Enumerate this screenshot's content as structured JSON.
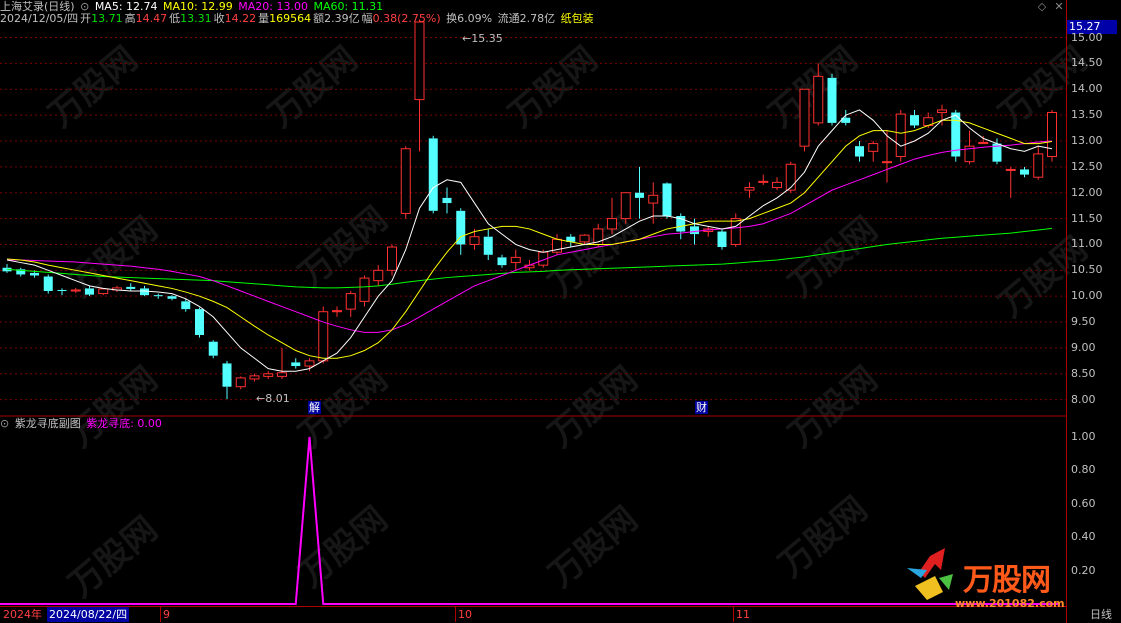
{
  "header": {
    "stock_name": "上海艾录(日线)",
    "ma5": "MA5: 12.74",
    "ma10": "MA10: 12.99",
    "ma20": "MA20: 13.00",
    "ma60": "MA60: 11.31",
    "date": "2024/12/05/四",
    "open_label": "开",
    "open": "13.71",
    "high_label": "高",
    "high": "14.47",
    "low_label": "低",
    "low": "13.31",
    "close_label": "收",
    "close": "14.22",
    "vol_label": "量",
    "vol": "169564",
    "amt_label": "额",
    "amt": "2.39亿",
    "chg_label": "幅",
    "chg": "0.38(2.75%)",
    "turnover": "换6.09%",
    "float": "流通2.78亿",
    "sector": "纸包装"
  },
  "indicator": {
    "name": "紫龙寻底副图",
    "value_label": "紫龙寻底: 0.00"
  },
  "price_axis": {
    "current": "15.27",
    "ticks": [
      "15.00",
      "14.50",
      "14.00",
      "13.50",
      "13.00",
      "12.50",
      "12.00",
      "11.50",
      "11.00",
      "10.50",
      "10.00",
      "9.50",
      "9.00",
      "8.50",
      "8.00"
    ]
  },
  "indicator_axis": {
    "ticks": [
      "1.00",
      "0.80",
      "0.60",
      "0.40",
      "0.20"
    ]
  },
  "annotations": {
    "high_marker": "15.35",
    "low_marker": "8.01",
    "event1": "解",
    "event2": "财"
  },
  "bottom_bar": {
    "year": "2024年",
    "cursor_date": "2024/08/22/四",
    "months": [
      "9",
      "10",
      "11"
    ],
    "period": "日线"
  },
  "watermark": {
    "brand": "万股网",
    "url": "www.201082.com"
  },
  "colors": {
    "up": "#ff3030",
    "down": "#54ffff",
    "ma5": "#ffffff",
    "ma10": "#ffff00",
    "ma20": "#ff00ff",
    "ma60": "#00ff00",
    "indicator": "#ff00ff"
  },
  "chart_data": {
    "type": "candlestick",
    "ylim": [
      7.8,
      15.3
    ],
    "candles": [
      {
        "o": 10.55,
        "h": 10.62,
        "l": 10.45,
        "c": 10.48
      },
      {
        "o": 10.52,
        "h": 10.55,
        "l": 10.38,
        "c": 10.42
      },
      {
        "o": 10.45,
        "h": 10.5,
        "l": 10.36,
        "c": 10.4
      },
      {
        "o": 10.38,
        "h": 10.42,
        "l": 10.05,
        "c": 10.1
      },
      {
        "o": 10.12,
        "h": 10.15,
        "l": 10.02,
        "c": 10.1
      },
      {
        "o": 10.1,
        "h": 10.16,
        "l": 10.06,
        "c": 10.12
      },
      {
        "o": 10.15,
        "h": 10.2,
        "l": 10.0,
        "c": 10.03
      },
      {
        "o": 10.05,
        "h": 10.16,
        "l": 10.02,
        "c": 10.14
      },
      {
        "o": 10.12,
        "h": 10.2,
        "l": 10.08,
        "c": 10.16
      },
      {
        "o": 10.18,
        "h": 10.25,
        "l": 10.1,
        "c": 10.14
      },
      {
        "o": 10.15,
        "h": 10.2,
        "l": 10.0,
        "c": 10.02
      },
      {
        "o": 10.02,
        "h": 10.05,
        "l": 9.95,
        "c": 10.0
      },
      {
        "o": 10.0,
        "h": 10.02,
        "l": 9.92,
        "c": 9.95
      },
      {
        "o": 9.9,
        "h": 9.95,
        "l": 9.7,
        "c": 9.75
      },
      {
        "o": 9.75,
        "h": 9.78,
        "l": 9.2,
        "c": 9.25
      },
      {
        "o": 9.12,
        "h": 9.15,
        "l": 8.8,
        "c": 8.85
      },
      {
        "o": 8.7,
        "h": 8.75,
        "l": 8.01,
        "c": 8.25
      },
      {
        "o": 8.25,
        "h": 8.45,
        "l": 8.2,
        "c": 8.42
      },
      {
        "o": 8.4,
        "h": 8.5,
        "l": 8.35,
        "c": 8.46
      },
      {
        "o": 8.45,
        "h": 8.55,
        "l": 8.4,
        "c": 8.5
      },
      {
        "o": 8.45,
        "h": 9.0,
        "l": 8.4,
        "c": 8.52
      },
      {
        "o": 8.72,
        "h": 8.8,
        "l": 8.6,
        "c": 8.65
      },
      {
        "o": 8.65,
        "h": 8.8,
        "l": 8.55,
        "c": 8.75
      },
      {
        "o": 8.75,
        "h": 9.8,
        "l": 8.7,
        "c": 9.7
      },
      {
        "o": 9.7,
        "h": 9.8,
        "l": 9.6,
        "c": 9.72
      },
      {
        "o": 9.75,
        "h": 10.1,
        "l": 9.6,
        "c": 10.05
      },
      {
        "o": 9.9,
        "h": 10.4,
        "l": 9.8,
        "c": 10.35
      },
      {
        "o": 10.3,
        "h": 10.6,
        "l": 10.2,
        "c": 10.5
      },
      {
        "o": 10.5,
        "h": 11.0,
        "l": 10.4,
        "c": 10.95
      },
      {
        "o": 11.6,
        "h": 12.9,
        "l": 11.5,
        "c": 12.85
      },
      {
        "o": 13.8,
        "h": 15.35,
        "l": 12.8,
        "c": 15.3
      },
      {
        "o": 13.05,
        "h": 13.1,
        "l": 11.6,
        "c": 11.65
      },
      {
        "o": 11.9,
        "h": 12.1,
        "l": 11.6,
        "c": 11.8
      },
      {
        "o": 11.65,
        "h": 11.7,
        "l": 10.8,
        "c": 11.0
      },
      {
        "o": 11.0,
        "h": 11.3,
        "l": 10.9,
        "c": 11.15
      },
      {
        "o": 11.15,
        "h": 11.3,
        "l": 10.7,
        "c": 10.8
      },
      {
        "o": 10.75,
        "h": 10.8,
        "l": 10.55,
        "c": 10.6
      },
      {
        "o": 10.65,
        "h": 10.9,
        "l": 10.5,
        "c": 10.75
      },
      {
        "o": 10.55,
        "h": 10.7,
        "l": 10.5,
        "c": 10.6
      },
      {
        "o": 10.6,
        "h": 10.9,
        "l": 10.55,
        "c": 10.85
      },
      {
        "o": 10.85,
        "h": 11.2,
        "l": 10.8,
        "c": 11.1
      },
      {
        "o": 11.15,
        "h": 11.2,
        "l": 10.95,
        "c": 11.05
      },
      {
        "o": 11.05,
        "h": 11.2,
        "l": 11.0,
        "c": 11.18
      },
      {
        "o": 11.0,
        "h": 11.4,
        "l": 10.95,
        "c": 11.3
      },
      {
        "o": 11.3,
        "h": 11.9,
        "l": 11.2,
        "c": 11.5
      },
      {
        "o": 11.5,
        "h": 12.0,
        "l": 11.4,
        "c": 12.0
      },
      {
        "o": 12.0,
        "h": 12.5,
        "l": 11.5,
        "c": 11.9
      },
      {
        "o": 11.8,
        "h": 12.2,
        "l": 11.4,
        "c": 11.95
      },
      {
        "o": 12.18,
        "h": 12.2,
        "l": 11.5,
        "c": 11.55
      },
      {
        "o": 11.55,
        "h": 11.6,
        "l": 11.1,
        "c": 11.25
      },
      {
        "o": 11.35,
        "h": 11.5,
        "l": 11.0,
        "c": 11.2
      },
      {
        "o": 11.25,
        "h": 11.35,
        "l": 11.15,
        "c": 11.3
      },
      {
        "o": 11.25,
        "h": 11.3,
        "l": 10.9,
        "c": 10.95
      },
      {
        "o": 11.0,
        "h": 11.6,
        "l": 10.95,
        "c": 11.5
      },
      {
        "o": 12.05,
        "h": 12.2,
        "l": 11.9,
        "c": 12.1
      },
      {
        "o": 12.2,
        "h": 12.35,
        "l": 12.15,
        "c": 12.22
      },
      {
        "o": 12.1,
        "h": 12.3,
        "l": 12.05,
        "c": 12.2
      },
      {
        "o": 12.05,
        "h": 12.6,
        "l": 12.0,
        "c": 12.55
      },
      {
        "o": 12.9,
        "h": 14.0,
        "l": 12.8,
        "c": 14.0
      },
      {
        "o": 13.35,
        "h": 14.5,
        "l": 13.3,
        "c": 14.25
      },
      {
        "o": 14.22,
        "h": 14.3,
        "l": 13.3,
        "c": 13.35
      },
      {
        "o": 13.45,
        "h": 13.6,
        "l": 13.3,
        "c": 13.35
      },
      {
        "o": 12.9,
        "h": 13.0,
        "l": 12.6,
        "c": 12.7
      },
      {
        "o": 12.8,
        "h": 13.0,
        "l": 12.6,
        "c": 12.95
      },
      {
        "o": 12.6,
        "h": 13.2,
        "l": 12.2,
        "c": 12.6
      },
      {
        "o": 12.7,
        "h": 13.6,
        "l": 12.6,
        "c": 13.52
      },
      {
        "o": 13.5,
        "h": 13.6,
        "l": 13.25,
        "c": 13.3
      },
      {
        "o": 13.3,
        "h": 13.55,
        "l": 13.25,
        "c": 13.45
      },
      {
        "o": 13.55,
        "h": 13.7,
        "l": 13.3,
        "c": 13.6
      },
      {
        "o": 13.55,
        "h": 13.6,
        "l": 12.6,
        "c": 12.7
      },
      {
        "o": 12.6,
        "h": 13.2,
        "l": 12.55,
        "c": 12.9
      },
      {
        "o": 12.95,
        "h": 13.1,
        "l": 12.95,
        "c": 12.97
      },
      {
        "o": 12.95,
        "h": 13.05,
        "l": 12.55,
        "c": 12.6
      },
      {
        "o": 12.45,
        "h": 12.5,
        "l": 11.9,
        "c": 12.45
      },
      {
        "o": 12.45,
        "h": 12.5,
        "l": 12.3,
        "c": 12.35
      },
      {
        "o": 12.3,
        "h": 12.9,
        "l": 12.25,
        "c": 12.75
      },
      {
        "o": 12.7,
        "h": 13.6,
        "l": 12.6,
        "c": 13.55
      }
    ],
    "ma5": [
      10.7,
      10.65,
      10.6,
      10.5,
      10.4,
      10.3,
      10.2,
      10.15,
      10.12,
      10.1,
      10.1,
      10.08,
      10.05,
      9.95,
      9.8,
      9.6,
      9.3,
      9.0,
      8.8,
      8.6,
      8.55,
      8.55,
      8.6,
      8.75,
      8.9,
      9.2,
      9.6,
      10.0,
      10.3,
      10.9,
      11.7,
      12.1,
      12.25,
      12.2,
      11.8,
      11.4,
      11.2,
      11.0,
      10.9,
      10.85,
      10.9,
      10.95,
      11.0,
      11.05,
      11.15,
      11.3,
      11.45,
      11.55,
      11.55,
      11.5,
      11.4,
      11.35,
      11.3,
      11.35,
      11.55,
      11.75,
      11.9,
      12.1,
      12.4,
      12.9,
      13.2,
      13.5,
      13.6,
      13.4,
      13.1,
      12.9,
      13.0,
      13.15,
      13.4,
      13.5,
      13.25,
      13.05,
      12.95,
      12.85,
      12.8,
      12.9,
      12.85
    ],
    "ma10": [
      10.72,
      10.7,
      10.66,
      10.6,
      10.55,
      10.5,
      10.45,
      10.4,
      10.35,
      10.3,
      10.25,
      10.2,
      10.15,
      10.08,
      10.0,
      9.9,
      9.78,
      9.6,
      9.42,
      9.25,
      9.1,
      8.95,
      8.85,
      8.8,
      8.8,
      8.85,
      8.95,
      9.1,
      9.35,
      9.7,
      10.1,
      10.5,
      10.85,
      11.15,
      11.25,
      11.3,
      11.35,
      11.35,
      11.3,
      11.2,
      11.1,
      11.05,
      11.0,
      11.0,
      11.0,
      11.05,
      11.1,
      11.2,
      11.3,
      11.35,
      11.4,
      11.45,
      11.45,
      11.45,
      11.5,
      11.6,
      11.7,
      11.8,
      12.0,
      12.3,
      12.6,
      12.9,
      13.1,
      13.2,
      13.2,
      13.15,
      13.2,
      13.3,
      13.4,
      13.4,
      13.35,
      13.25,
      13.15,
      13.05,
      12.95,
      12.95,
      12.99
    ],
    "ma20": [
      10.7,
      10.7,
      10.69,
      10.68,
      10.67,
      10.66,
      10.64,
      10.62,
      10.6,
      10.58,
      10.55,
      10.52,
      10.48,
      10.43,
      10.38,
      10.3,
      10.2,
      10.1,
      10.0,
      9.9,
      9.8,
      9.7,
      9.6,
      9.5,
      9.42,
      9.35,
      9.3,
      9.3,
      9.35,
      9.45,
      9.6,
      9.75,
      9.9,
      10.05,
      10.2,
      10.3,
      10.4,
      10.5,
      10.6,
      10.7,
      10.8,
      10.85,
      10.9,
      10.95,
      11.0,
      11.05,
      11.1,
      11.15,
      11.2,
      11.22,
      11.25,
      11.28,
      11.3,
      11.32,
      11.35,
      11.4,
      11.5,
      11.6,
      11.75,
      11.9,
      12.05,
      12.15,
      12.25,
      12.35,
      12.45,
      12.55,
      12.65,
      12.72,
      12.78,
      12.82,
      12.85,
      12.88,
      12.9,
      12.92,
      12.95,
      12.98,
      13.0
    ],
    "ma60": [
      10.52,
      10.5,
      10.48,
      10.46,
      10.44,
      10.42,
      10.4,
      10.38,
      10.37,
      10.36,
      10.35,
      10.34,
      10.33,
      10.32,
      10.31,
      10.3,
      10.28,
      10.26,
      10.24,
      10.22,
      10.2,
      10.18,
      10.17,
      10.16,
      10.16,
      10.17,
      10.18,
      10.2,
      10.23,
      10.27,
      10.3,
      10.33,
      10.36,
      10.38,
      10.4,
      10.42,
      10.44,
      10.46,
      10.47,
      10.48,
      10.5,
      10.51,
      10.52,
      10.53,
      10.54,
      10.55,
      10.56,
      10.57,
      10.58,
      10.59,
      10.6,
      10.61,
      10.62,
      10.64,
      10.66,
      10.68,
      10.7,
      10.73,
      10.76,
      10.8,
      10.84,
      10.88,
      10.92,
      10.96,
      11.0,
      11.03,
      11.06,
      11.09,
      11.12,
      11.14,
      11.16,
      11.18,
      11.2,
      11.22,
      11.25,
      11.28,
      11.31
    ],
    "indicator_values": [
      0,
      0,
      0,
      0,
      0,
      0,
      0,
      0,
      0,
      0,
      0,
      0,
      0,
      0,
      0,
      0,
      0,
      0,
      0,
      0,
      0,
      0,
      1,
      0,
      0,
      0,
      0,
      0,
      0,
      0,
      0,
      0,
      0,
      0,
      0,
      0,
      0,
      0,
      0,
      0,
      0,
      0,
      0,
      0,
      0,
      0,
      0,
      0,
      0,
      0,
      0,
      0,
      0,
      0,
      0,
      0,
      0,
      0,
      0,
      0,
      0,
      0,
      0,
      0,
      0,
      0,
      0,
      0,
      0,
      0,
      0,
      0,
      0,
      0,
      0,
      0,
      0
    ],
    "indicator_ylim": [
      0,
      1
    ]
  }
}
